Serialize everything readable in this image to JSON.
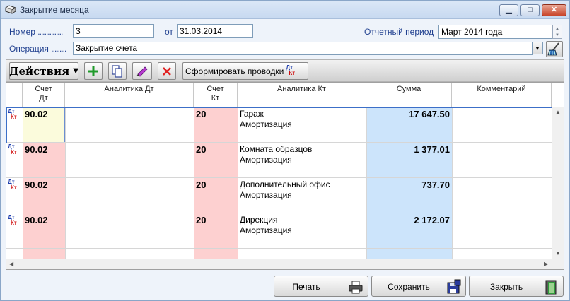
{
  "window": {
    "title": "Закрытие месяца",
    "buttons": {
      "minimize": "▁",
      "maximize": "□",
      "close": "✕"
    }
  },
  "form": {
    "number_label": "Номер",
    "number_value": "3",
    "date_label": "от",
    "date_value": "31.03.2014",
    "period_label": "Отчетный период",
    "period_value": "Март 2014 года",
    "operation_label": "Операция",
    "operation_value": "Закрытие счета"
  },
  "toolbar": {
    "actions_label": "Действия",
    "post_label": "Сформировать проводки",
    "icons": [
      "add-icon",
      "copy-icon",
      "edit-icon",
      "delete-icon",
      "dt-kt-icon"
    ]
  },
  "grid": {
    "columns": {
      "acc_dt": "Счет Дт",
      "analytics_dt": "Аналитика Дт",
      "acc_kt": "Счет Кт",
      "analytics_kt": "Аналитика Кт",
      "amount": "Сумма",
      "comment": "Комментарий"
    },
    "dtkt_marker": {
      "dt": "Дт",
      "kt": "Кт"
    },
    "rows": [
      {
        "acc_dt": "90.02",
        "analytics_dt": "",
        "acc_kt": "20",
        "analytics_kt_1": "Гараж",
        "analytics_kt_2": "Амортизация",
        "amount": "17 647.50",
        "comment": ""
      },
      {
        "acc_dt": "90.02",
        "analytics_dt": "",
        "acc_kt": "20",
        "analytics_kt_1": "Комната образцов",
        "analytics_kt_2": "Амортизация",
        "amount": "1 377.01",
        "comment": ""
      },
      {
        "acc_dt": "90.02",
        "analytics_dt": "",
        "acc_kt": "20",
        "analytics_kt_1": "Дополнительный офис",
        "analytics_kt_2": "Амортизация",
        "amount": "737.70",
        "comment": ""
      },
      {
        "acc_dt": "90.02",
        "analytics_dt": "",
        "acc_kt": "20",
        "analytics_kt_1": "Дирекция",
        "analytics_kt_2": "Амортизация",
        "amount": "2 172.07",
        "comment": ""
      }
    ]
  },
  "footer": {
    "print_label": "Печать",
    "save_label": "Сохранить",
    "close_label": "Закрыть"
  },
  "colors": {
    "acc_dt_bg": "#fdd0d0",
    "acc_kt_bg": "#fdd0d0",
    "amount_bg": "#cce4fb",
    "label_color": "#1f3f8f"
  }
}
